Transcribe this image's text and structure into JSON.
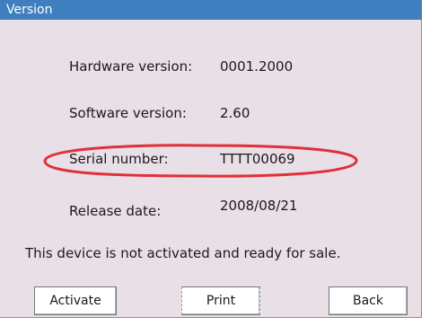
{
  "window": {
    "title": "Version"
  },
  "rows": [
    {
      "label": "Hardware version:",
      "value": "0001.2000"
    },
    {
      "label": "Software version:",
      "value": "2.60"
    },
    {
      "label": "Serial number:",
      "value": "TTTT00069"
    },
    {
      "label": "Release date:",
      "value": "2008/08/21"
    }
  ],
  "status_message": "This device is not activated and ready for sale.",
  "buttons": {
    "activate": "Activate",
    "print": "Print",
    "back": "Back"
  },
  "colors": {
    "title_bar": "#3f7fc0",
    "background": "#e9dfe6",
    "highlight_ring": "#e0303a"
  }
}
